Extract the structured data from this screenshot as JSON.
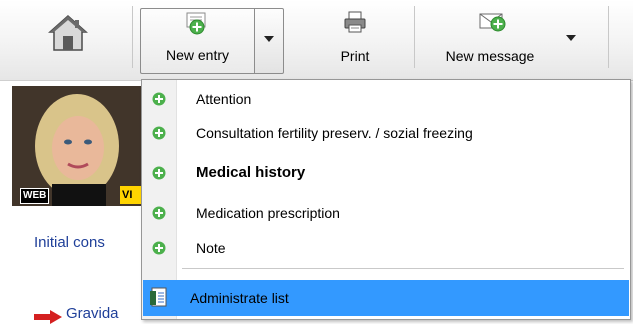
{
  "toolbar": {
    "home": {
      "icon": "home-icon"
    },
    "new_entry": {
      "label": "New entry",
      "icon": "add-document-icon"
    },
    "print": {
      "label": "Print",
      "icon": "printer-icon"
    },
    "new_message": {
      "label": "New message",
      "icon": "envelope-add-icon"
    }
  },
  "profile": {
    "badge_web": "WEB",
    "badge_vip": "VI",
    "initial_text": "Initial cons",
    "gravida_text": "Gravida"
  },
  "dropdown": {
    "items": [
      {
        "label": "Attention",
        "icon": "plus-circle-icon"
      },
      {
        "label": "Consultation fertility preserv. / sozial freezing",
        "icon": "plus-circle-icon"
      },
      {
        "label": "Medical history",
        "icon": "plus-circle-icon",
        "bold": true
      },
      {
        "label": "Medication prescription",
        "icon": "plus-circle-icon"
      },
      {
        "label": "Note",
        "icon": "plus-circle-icon"
      }
    ],
    "admin": {
      "label": "Administrate list",
      "icon": "list-document-icon",
      "selected": true
    }
  },
  "colors": {
    "accent": "#3399ff",
    "plus": "#4cb04c",
    "link": "#1f3f99"
  }
}
